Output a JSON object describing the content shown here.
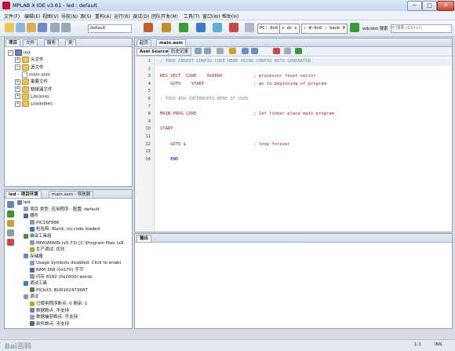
{
  "window": {
    "title": "MPLAB X IDE v3.61 - led : default",
    "minimize": "−",
    "maximize": "□",
    "close": "✕"
  },
  "menu": [
    "文件(F)",
    "编辑(E)",
    "视图(V)",
    "导航(N)",
    "源(S)",
    "重构(A)",
    "运行(R)",
    "调试(D)",
    "团队开发(M)",
    "工具(T)",
    "窗口(W)",
    "帮助(H)"
  ],
  "toolbar": {
    "config_value": "default",
    "pc": "PC: 0x0",
    "status": "z dc c",
    "wreg": ": W:0x0 : bank 0",
    "hint": "wikidot 搜索",
    "search_placeholder": "搜索 (Ctrl+I)"
  },
  "projects_panel": {
    "tabs": [
      "项目",
      "文件",
      "服务",
      "类"
    ],
    "tree": [
      {
        "label": "led",
        "kind": "proj",
        "level": 0
      },
      {
        "label": "头文件",
        "kind": "folder",
        "level": 1
      },
      {
        "label": "源文件",
        "kind": "folder",
        "level": 1
      },
      {
        "label": "main.asm",
        "kind": "file",
        "level": 2
      },
      {
        "label": "重要文件",
        "kind": "folder",
        "level": 1
      },
      {
        "label": "链接器文件",
        "kind": "folder",
        "level": 1
      },
      {
        "label": "Libraries",
        "kind": "folder",
        "level": 1
      },
      {
        "label": "Loadables",
        "kind": "folder",
        "level": 1
      }
    ]
  },
  "dashboard_panel": {
    "tabs": [
      "led - 项目环境",
      "main.asm - 导航器"
    ],
    "rows": [
      {
        "label": "led",
        "level": 0
      },
      {
        "label": "项目 类型: 应用程序 - 配置: default",
        "level": 1
      },
      {
        "label": "器件",
        "level": 1
      },
      {
        "label": "PIC16F886",
        "level": 2
      },
      {
        "label": "检验和: Blank, no code loaded",
        "level": 2
      },
      {
        "label": "编译工具组",
        "level": 1
      },
      {
        "label": "MPASMWIN (v5.73) [C:\\Program Files (x8",
        "level": 2
      },
      {
        "label": "生产调试: 优化",
        "level": 2
      },
      {
        "label": "存储器",
        "level": 1
      },
      {
        "label": "Usage Symbols disabled. Click to enabl",
        "level": 2
      },
      {
        "label": "RAM 368 (0x170) 字节",
        "level": 2
      },
      {
        "label": "闪存 8192 (0x2000) words",
        "level": 2
      },
      {
        "label": "调试工具",
        "level": 1
      },
      {
        "label": "PICkit3: BUR162473687",
        "level": 2
      },
      {
        "label": "调试",
        "level": 1
      },
      {
        "label": "已使用程序断点: 0   剩余: 1",
        "level": 2
      },
      {
        "label": "数据断点: 不支持",
        "level": 2
      },
      {
        "label": "数据捕获断点: 不支持",
        "level": 2
      },
      {
        "label": "软件断点: 不支持",
        "level": 2
      }
    ]
  },
  "editor": {
    "tabs": [
      "起页",
      "main.asm"
    ],
    "subtabs": [
      "Asm Source",
      "历史记录"
    ],
    "lines": [
      {
        "n": "1",
        "text": "; TODO INSERT CONFIG CODE HERE USING CONFIG BITS GENERATOR",
        "cls": "cmt"
      },
      {
        "n": "2",
        "text": "",
        "cls": ""
      },
      {
        "n": "3",
        "text": "RES_VECT  CODE    0x0000            ; processor reset vector",
        "cls": "mix"
      },
      {
        "n": "4",
        "text": "    GOTO    START                   ; go to beginning of program",
        "cls": "mix"
      },
      {
        "n": "5",
        "text": "",
        "cls": ""
      },
      {
        "n": "6",
        "text": "; TODO ADD INTERRUPTS HERE IF USED",
        "cls": "cmt"
      },
      {
        "n": "7",
        "text": "",
        "cls": ""
      },
      {
        "n": "8",
        "text": "MAIN_PROG CODE                      ; let linker place main program",
        "cls": "mix"
      },
      {
        "n": "9",
        "text": "",
        "cls": ""
      },
      {
        "n": "10",
        "text": "START",
        "cls": "lbl"
      },
      {
        "n": "11",
        "text": "",
        "cls": ""
      },
      {
        "n": "12",
        "text": "    GOTO $                          ; loop forever",
        "cls": "mix"
      },
      {
        "n": "13",
        "text": "",
        "cls": ""
      },
      {
        "n": "14",
        "text": "    END",
        "cls": "kw"
      }
    ]
  },
  "output_panel": {
    "title": "输出"
  },
  "status": {
    "position": "1:1",
    "mode": "INS",
    "watermark": "Bai百科"
  }
}
